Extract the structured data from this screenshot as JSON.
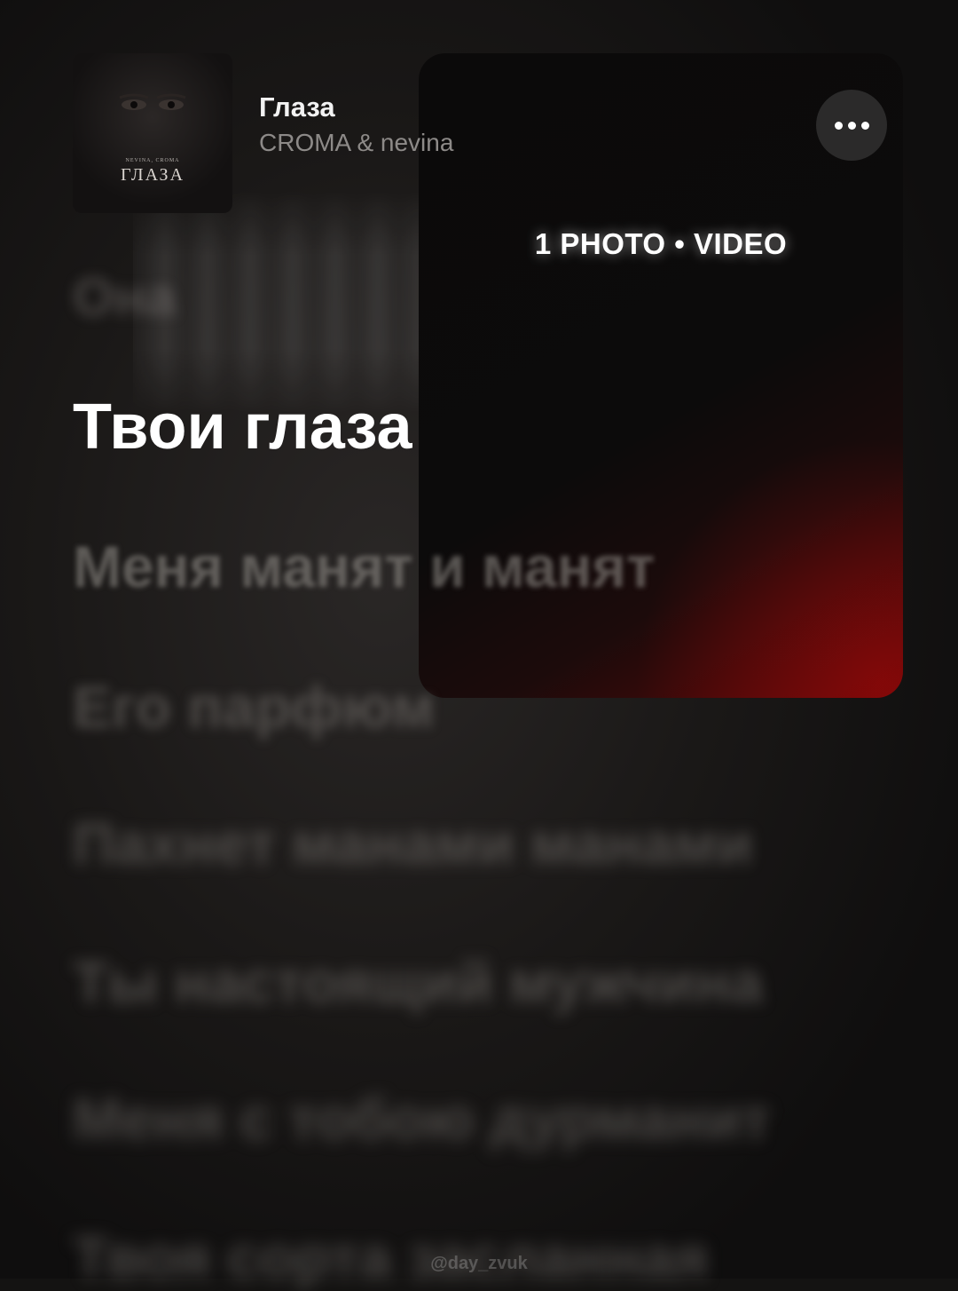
{
  "track": {
    "title": "Глаза",
    "artist": "CROMA & nevina"
  },
  "cover": {
    "artists": "NEVINA, CROMA",
    "title": "ГЛАЗА"
  },
  "story": {
    "media_label": "1 PHOTO • VIDEO",
    "more_icon": "more-horizontal-icon"
  },
  "lyrics": {
    "previous": "Она",
    "active": "Твои глаза",
    "upcoming": [
      "Меня манят и манят",
      "Его парфюм",
      "Пахнет манами манами",
      "Ты настоящий мужчина",
      "Меня с тобою дурманит",
      "Твоя сорта засланная"
    ]
  },
  "watermark": "@day_zvuk",
  "colors": {
    "background": "#141312",
    "accent_red": "#5a0707",
    "active_lyric": "#ffffff",
    "muted_text": "#8d8a88"
  }
}
